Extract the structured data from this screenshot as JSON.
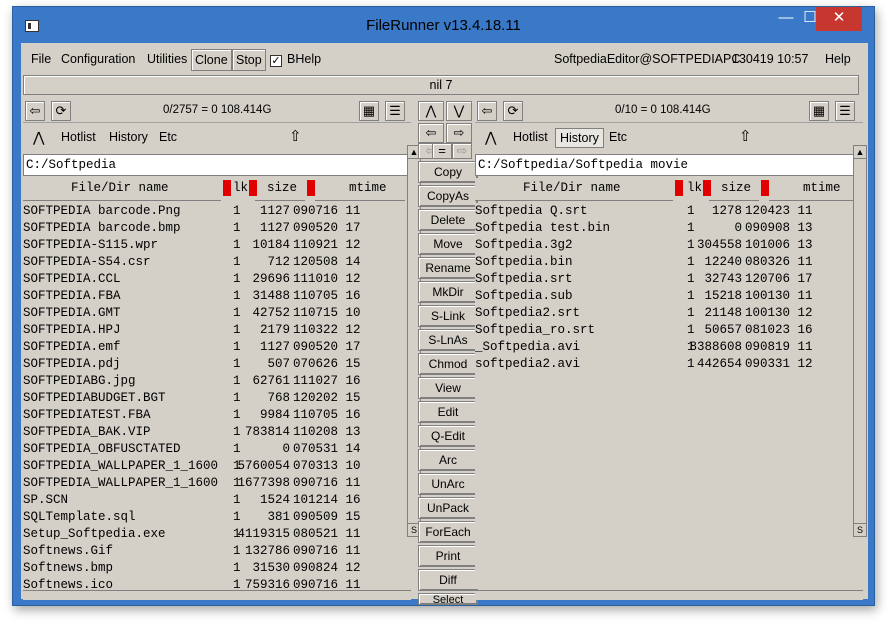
{
  "window": {
    "title": "FileRunner  v13.4.18.11",
    "min": "—",
    "max": "☐",
    "close": "✕"
  },
  "menu": {
    "file": "File",
    "configuration": "Configuration",
    "utilities": "Utilities",
    "clone": "Clone",
    "stop": "Stop",
    "bhelp": "BHelp",
    "bhelp_checked": "✓",
    "user": "SoftpediaEditor@SOFTPEDIAPC",
    "datetime": "130419 10:57",
    "help": "Help"
  },
  "status": "nil 7",
  "left": {
    "info": "0/2757 = 0  108.414G",
    "hotlist": "Hotlist",
    "history": "History",
    "etc": "Etc",
    "path": "C:/Softpedia",
    "headers": {
      "name": "File/Dir name",
      "lk": "lk",
      "size": "size",
      "mtime": "mtime"
    },
    "files": [
      {
        "name": "SOFTPEDIA barcode.Png",
        "lk": "1",
        "size": "1127",
        "mtime": "090716 11"
      },
      {
        "name": "SOFTPEDIA barcode.bmp",
        "lk": "1",
        "size": "1127",
        "mtime": "090520 17"
      },
      {
        "name": "SOFTPEDIA-S115.wpr",
        "lk": "1",
        "size": "10184",
        "mtime": "110921 12"
      },
      {
        "name": "SOFTPEDIA-S54.csr",
        "lk": "1",
        "size": "712",
        "mtime": "120508 14"
      },
      {
        "name": "SOFTPEDIA.CCL",
        "lk": "1",
        "size": "29696",
        "mtime": "111010 12"
      },
      {
        "name": "SOFTPEDIA.FBA",
        "lk": "1",
        "size": "31488",
        "mtime": "110705 16"
      },
      {
        "name": "SOFTPEDIA.GMT",
        "lk": "1",
        "size": "42752",
        "mtime": "110715 10"
      },
      {
        "name": "SOFTPEDIA.HPJ",
        "lk": "1",
        "size": "2179",
        "mtime": "110322 12"
      },
      {
        "name": "SOFTPEDIA.emf",
        "lk": "1",
        "size": "1127",
        "mtime": "090520 17"
      },
      {
        "name": "SOFTPEDIA.pdj",
        "lk": "1",
        "size": "507",
        "mtime": "070626 15"
      },
      {
        "name": "SOFTPEDIABG.jpg",
        "lk": "1",
        "size": "62761",
        "mtime": "111027 16"
      },
      {
        "name": "SOFTPEDIABUDGET.BGT",
        "lk": "1",
        "size": "768",
        "mtime": "120202 15"
      },
      {
        "name": "SOFTPEDIATEST.FBA",
        "lk": "1",
        "size": "9984",
        "mtime": "110705 16"
      },
      {
        "name": "SOFTPEDIA_BAK.VIP",
        "lk": "1",
        "size": "783814",
        "mtime": "110208 13"
      },
      {
        "name": "SOFTPEDIA_OBFUSCTATED",
        "lk": "1",
        "size": "0",
        "mtime": "070531 14"
      },
      {
        "name": "SOFTPEDIA_WALLPAPER_1_1600",
        "lk": "1",
        "size": "5760054",
        "mtime": "070313 10"
      },
      {
        "name": "SOFTPEDIA_WALLPAPER_1_1600",
        "lk": "1",
        "size": "1677398",
        "mtime": "090716 11"
      },
      {
        "name": "SP.SCN",
        "lk": "1",
        "size": "1524",
        "mtime": "101214 16"
      },
      {
        "name": "SQLTemplate.sql",
        "lk": "1",
        "size": "381",
        "mtime": "090509 15"
      },
      {
        "name": "Setup_Softpedia.exe",
        "lk": "1",
        "size": "4119315",
        "mtime": "080521 11"
      },
      {
        "name": "Softnews.Gif",
        "lk": "1",
        "size": "132786",
        "mtime": "090716 11"
      },
      {
        "name": "Softnews.bmp",
        "lk": "1",
        "size": "31530",
        "mtime": "090824 12"
      },
      {
        "name": "Softnews.ico",
        "lk": "1",
        "size": "759316",
        "mtime": "090716 11"
      }
    ]
  },
  "right": {
    "info": "0/10 = 0  108.414G",
    "hotlist": "Hotlist",
    "history": "History",
    "etc": "Etc",
    "path": "C:/Softpedia/Softpedia movie",
    "headers": {
      "name": "File/Dir name",
      "lk": "lk",
      "size": "size",
      "mtime": "mtime"
    },
    "files": [
      {
        "name": "Softpedia Q.srt",
        "lk": "1",
        "size": "1278",
        "mtime": "120423 11"
      },
      {
        "name": "Softpedia test.bin",
        "lk": "1",
        "size": "0",
        "mtime": "090908 13"
      },
      {
        "name": "Softpedia.3g2",
        "lk": "1",
        "size": "304558",
        "mtime": "101006 13"
      },
      {
        "name": "Softpedia.bin",
        "lk": "1",
        "size": "12240",
        "mtime": "080326 11"
      },
      {
        "name": "Softpedia.srt",
        "lk": "1",
        "size": "32743",
        "mtime": "120706 17"
      },
      {
        "name": "Softpedia.sub",
        "lk": "1",
        "size": "15218",
        "mtime": "100130 11"
      },
      {
        "name": "Softpedia2.srt",
        "lk": "1",
        "size": "21148",
        "mtime": "100130 12"
      },
      {
        "name": "Softpedia_ro.srt",
        "lk": "1",
        "size": "50657",
        "mtime": "081023 16"
      },
      {
        "name": "_Softpedia.avi",
        "lk": "1",
        "size": "8388608",
        "mtime": "090819 11"
      },
      {
        "name": "softpedia2.avi",
        "lk": "1",
        "size": "442654",
        "mtime": "090331 12"
      }
    ]
  },
  "middle": {
    "eq": "=",
    "buttons": [
      "Copy",
      "CopyAs",
      "Delete",
      "Move",
      "Rename",
      "MkDir",
      "S-Link",
      "S-LnAs",
      "Chmod",
      "View",
      "Edit",
      "Q-Edit",
      "Arc",
      "UnArc",
      "UnPack",
      "ForEach",
      "Print",
      "Diff",
      "Select"
    ]
  }
}
